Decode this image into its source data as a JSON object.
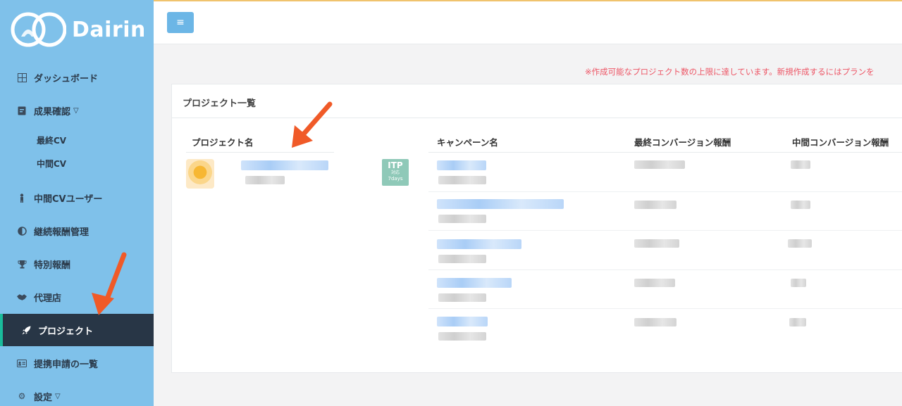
{
  "app": {
    "logo_text": "Dairin"
  },
  "sidebar": {
    "items": [
      {
        "label": "ダッシュボード",
        "icon": "dashboard-icon"
      },
      {
        "label": "成果確認",
        "icon": "results-icon"
      },
      {
        "label": "中間CVユーザー",
        "icon": "user-icon"
      },
      {
        "label": "継続報酬管理",
        "icon": "half-circle-icon"
      },
      {
        "label": "特別報酬",
        "icon": "trophy-icon"
      },
      {
        "label": "代理店",
        "icon": "handshake-icon"
      },
      {
        "label": "プロジェクト",
        "icon": "rocket-icon",
        "active": true
      },
      {
        "label": "提携申請の一覧",
        "icon": "id-card-icon"
      },
      {
        "label": "設定",
        "icon": "gear-icon"
      }
    ],
    "sub_items": [
      {
        "label": "最終CV"
      },
      {
        "label": "中間CV"
      }
    ]
  },
  "topbar": {
    "menu_icon": "hamburger-icon"
  },
  "warning": "※作成可能なプロジェクト数の上限に達しています。新規作成するにはプランを",
  "panel": {
    "title": "プロジェクト一覧",
    "columns": [
      "プロジェクト名",
      "キャンペーン名",
      "最終コンバージョン報酬",
      "中間コンバージョン報酬"
    ],
    "badge": {
      "title": "ITP",
      "line2": "対応",
      "line3": "7days"
    }
  },
  "colors": {
    "sidebar": "#7fc1ea",
    "active": "#283646",
    "accent": "#1abc9c",
    "warning": "#ed5565",
    "arrow": "#f05a28"
  }
}
